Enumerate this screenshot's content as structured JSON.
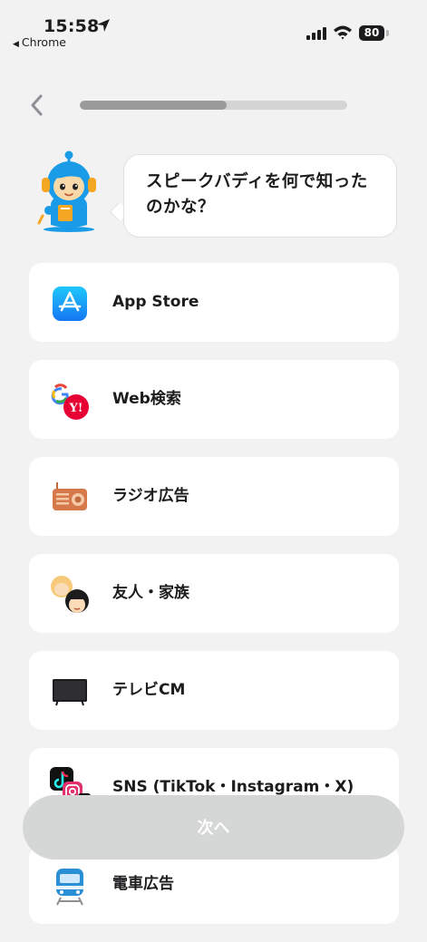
{
  "status_bar": {
    "time": "15:58",
    "back_app": "Chrome",
    "battery": "80"
  },
  "onboarding": {
    "progress_fraction": 0.55
  },
  "question": {
    "text": "スピークバディを何で知ったのかな？"
  },
  "options": [
    {
      "label": "App Store",
      "icon": "app-store-icon"
    },
    {
      "label": "Web検索",
      "icon": "google-yahoo-icon"
    },
    {
      "label": "ラジオ広告",
      "icon": "radio-icon"
    },
    {
      "label": "友人・家族",
      "icon": "friends-family-icon"
    },
    {
      "label": "テレビCM",
      "icon": "tv-icon"
    },
    {
      "label": "SNS (TikTok・Instagram・X)",
      "icon": "sns-icon"
    },
    {
      "label": "電車広告",
      "icon": "train-icon"
    }
  ],
  "next_button": {
    "label": "次へ"
  },
  "colors": {
    "background": "#f2f2f2",
    "card": "#ffffff",
    "button_disabled": "#d5d7d6",
    "mascot_blue": "#1a9be8"
  }
}
